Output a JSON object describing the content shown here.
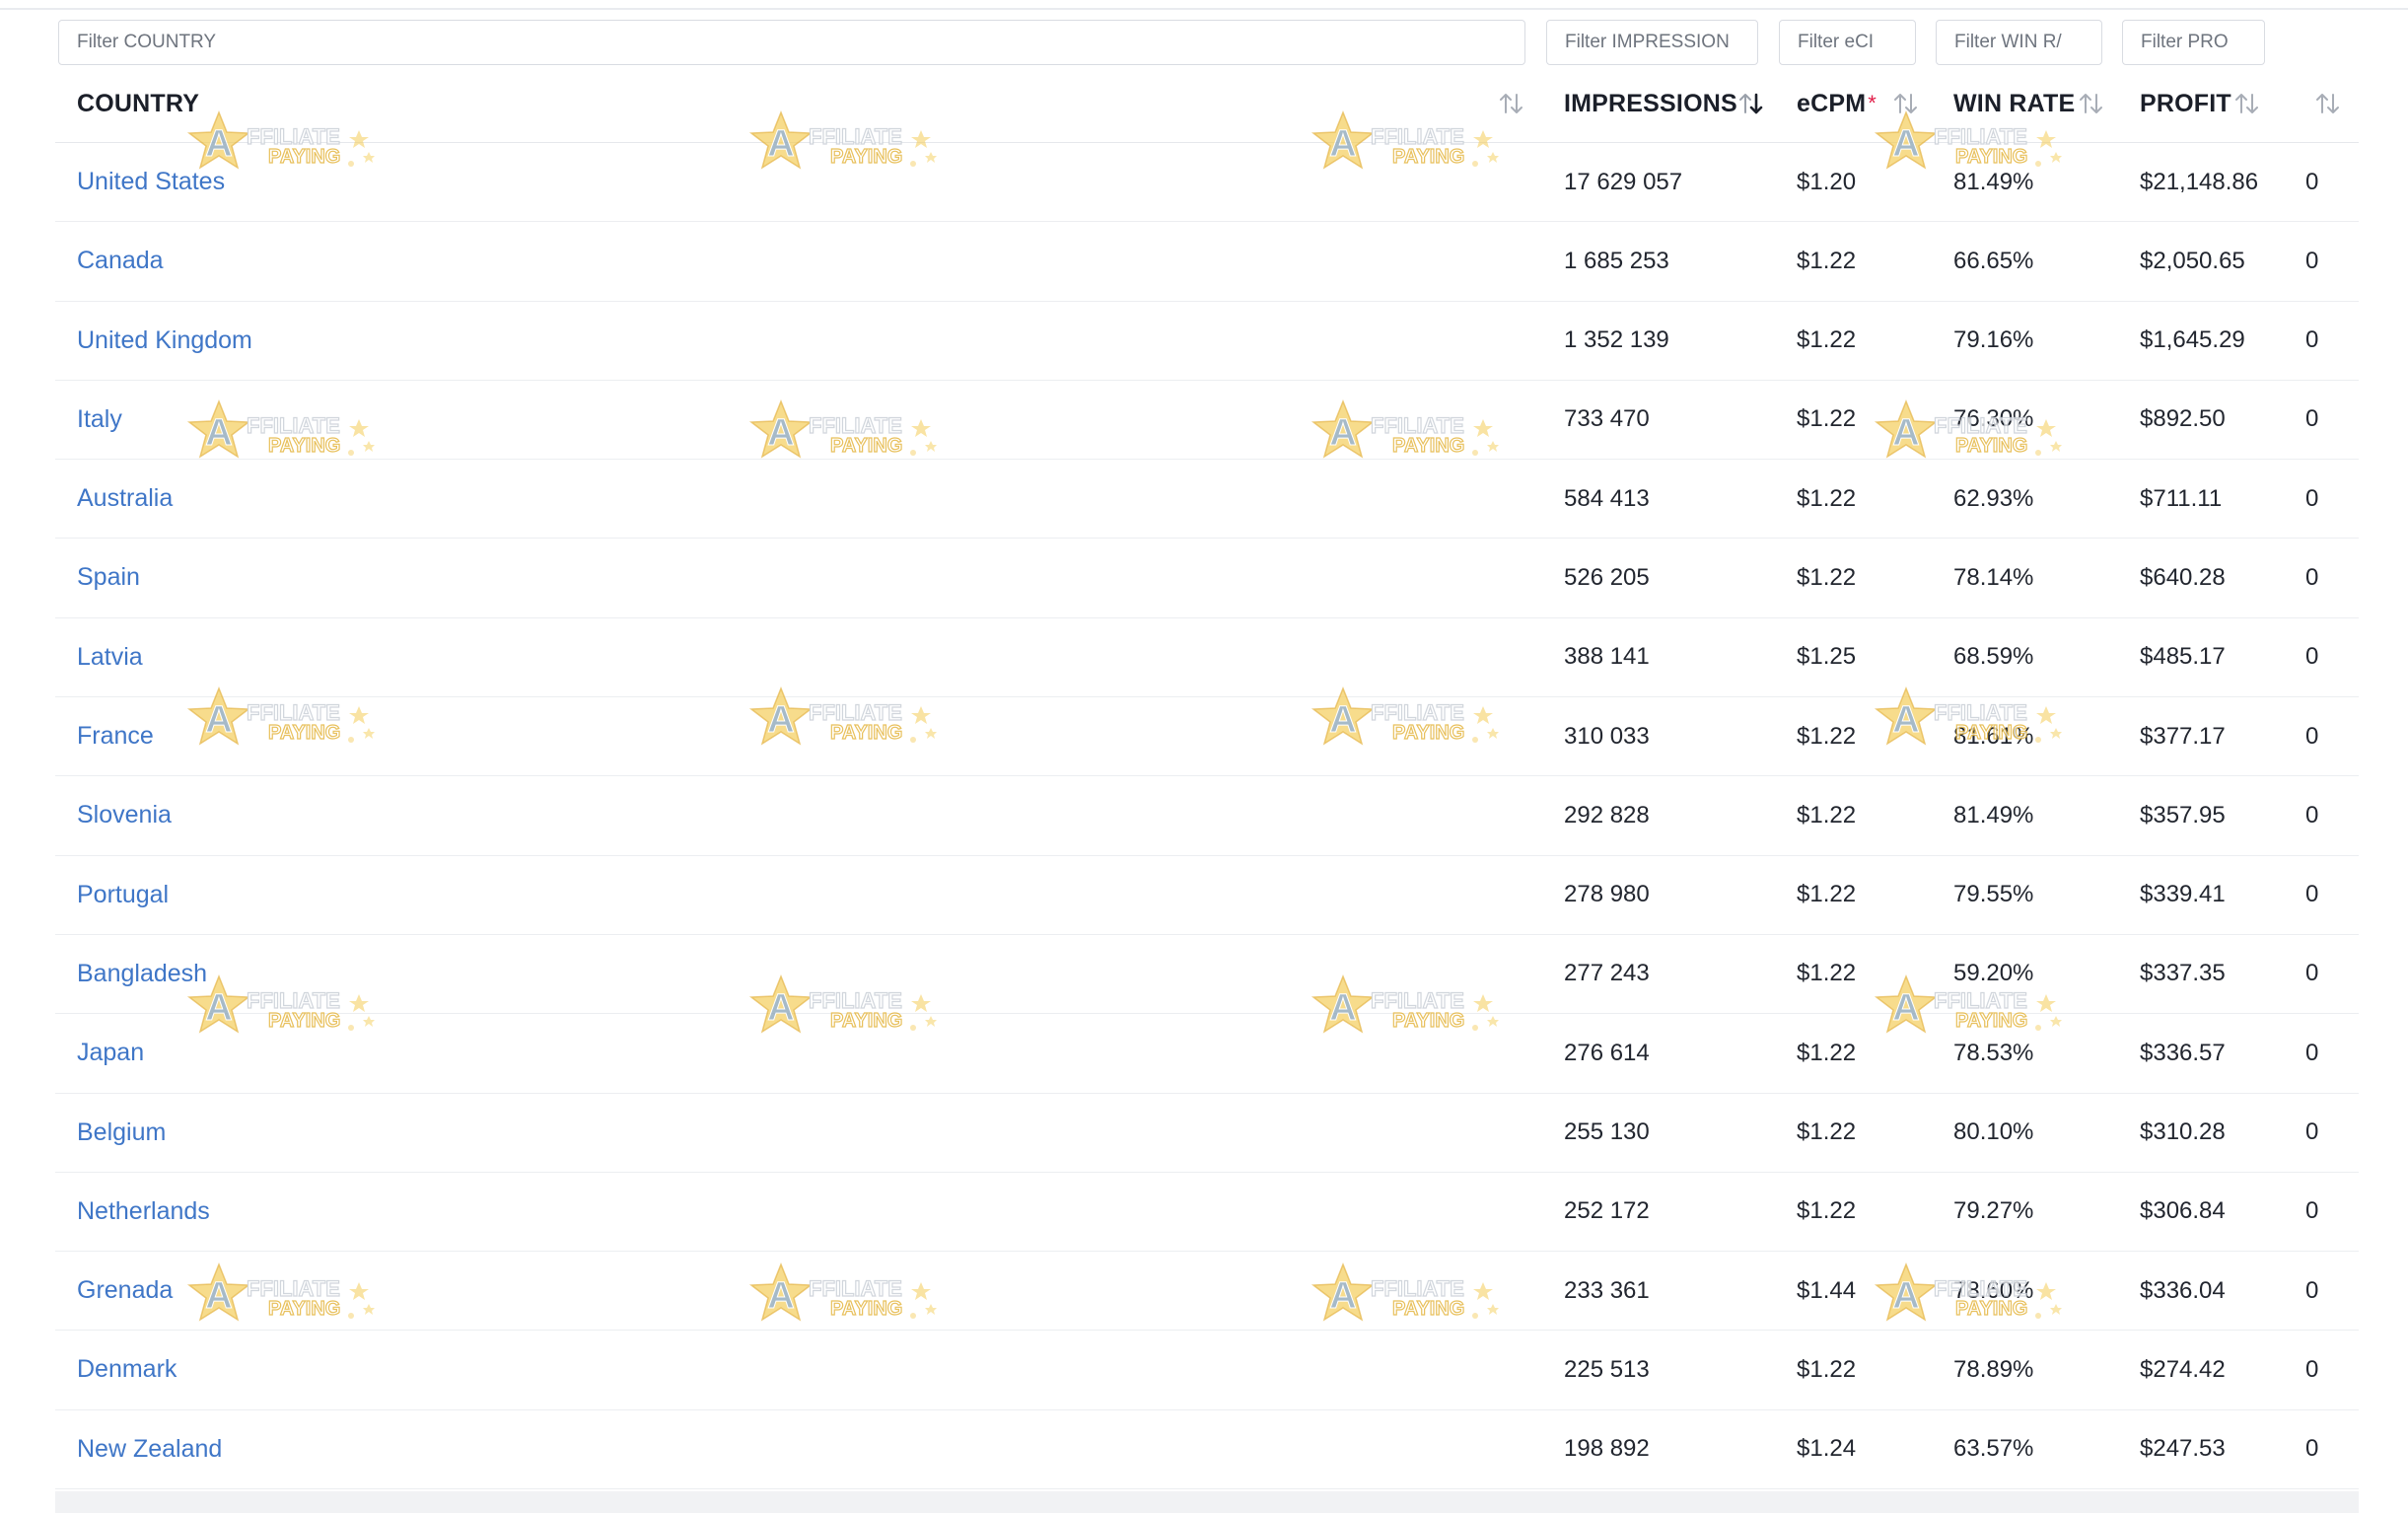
{
  "filters": {
    "country_placeholder": "Filter COUNTRY",
    "impressions_placeholder": "Filter IMPRESSION",
    "ecpm_placeholder": "Filter eCI",
    "win_rate_placeholder": "Filter WIN R/",
    "profit_placeholder": "Filter PRO"
  },
  "columns": {
    "country": "COUNTRY",
    "impressions": "IMPRESSIONS",
    "ecpm": "eCPM",
    "ecpm_required_mark": "*",
    "win_rate": "WIN RATE",
    "profit": "PROFIT"
  },
  "sort": {
    "active_column": "impressions",
    "active_direction": "desc"
  },
  "rows": [
    {
      "country": "United States",
      "impressions": "17 629 057",
      "ecpm": "$1.20",
      "win_rate": "81.49%",
      "profit": "$21,148.86",
      "extra": "0"
    },
    {
      "country": "Canada",
      "impressions": "1 685 253",
      "ecpm": "$1.22",
      "win_rate": "66.65%",
      "profit": "$2,050.65",
      "extra": "0"
    },
    {
      "country": "United Kingdom",
      "impressions": "1 352 139",
      "ecpm": "$1.22",
      "win_rate": "79.16%",
      "profit": "$1,645.29",
      "extra": "0"
    },
    {
      "country": "Italy",
      "impressions": "733 470",
      "ecpm": "$1.22",
      "win_rate": "76.30%",
      "profit": "$892.50",
      "extra": "0"
    },
    {
      "country": "Australia",
      "impressions": "584 413",
      "ecpm": "$1.22",
      "win_rate": "62.93%",
      "profit": "$711.11",
      "extra": "0"
    },
    {
      "country": "Spain",
      "impressions": "526 205",
      "ecpm": "$1.22",
      "win_rate": "78.14%",
      "profit": "$640.28",
      "extra": "0"
    },
    {
      "country": "Latvia",
      "impressions": "388 141",
      "ecpm": "$1.25",
      "win_rate": "68.59%",
      "profit": "$485.17",
      "extra": "0"
    },
    {
      "country": "France",
      "impressions": "310 033",
      "ecpm": "$1.22",
      "win_rate": "81.61%",
      "profit": "$377.17",
      "extra": "0"
    },
    {
      "country": "Slovenia",
      "impressions": "292 828",
      "ecpm": "$1.22",
      "win_rate": "81.49%",
      "profit": "$357.95",
      "extra": "0"
    },
    {
      "country": "Portugal",
      "impressions": "278 980",
      "ecpm": "$1.22",
      "win_rate": "79.55%",
      "profit": "$339.41",
      "extra": "0"
    },
    {
      "country": "Bangladesh",
      "impressions": "277 243",
      "ecpm": "$1.22",
      "win_rate": "59.20%",
      "profit": "$337.35",
      "extra": "0"
    },
    {
      "country": "Japan",
      "impressions": "276 614",
      "ecpm": "$1.22",
      "win_rate": "78.53%",
      "profit": "$336.57",
      "extra": "0"
    },
    {
      "country": "Belgium",
      "impressions": "255 130",
      "ecpm": "$1.22",
      "win_rate": "80.10%",
      "profit": "$310.28",
      "extra": "0"
    },
    {
      "country": "Netherlands",
      "impressions": "252 172",
      "ecpm": "$1.22",
      "win_rate": "79.27%",
      "profit": "$306.84",
      "extra": "0"
    },
    {
      "country": "Grenada",
      "impressions": "233 361",
      "ecpm": "$1.44",
      "win_rate": "78.60%",
      "profit": "$336.04",
      "extra": "0"
    },
    {
      "country": "Denmark",
      "impressions": "225 513",
      "ecpm": "$1.22",
      "win_rate": "78.89%",
      "profit": "$274.42",
      "extra": "0"
    },
    {
      "country": "New Zealand",
      "impressions": "198 892",
      "ecpm": "$1.24",
      "win_rate": "63.57%",
      "profit": "$247.53",
      "extra": "0"
    }
  ],
  "watermark": {
    "text_top": "FFILIATE",
    "text_bottom": "PAYING",
    "letter": "A"
  },
  "colors": {
    "link": "#3f76c7",
    "required": "#e11d48",
    "border": "#d9dce2"
  }
}
